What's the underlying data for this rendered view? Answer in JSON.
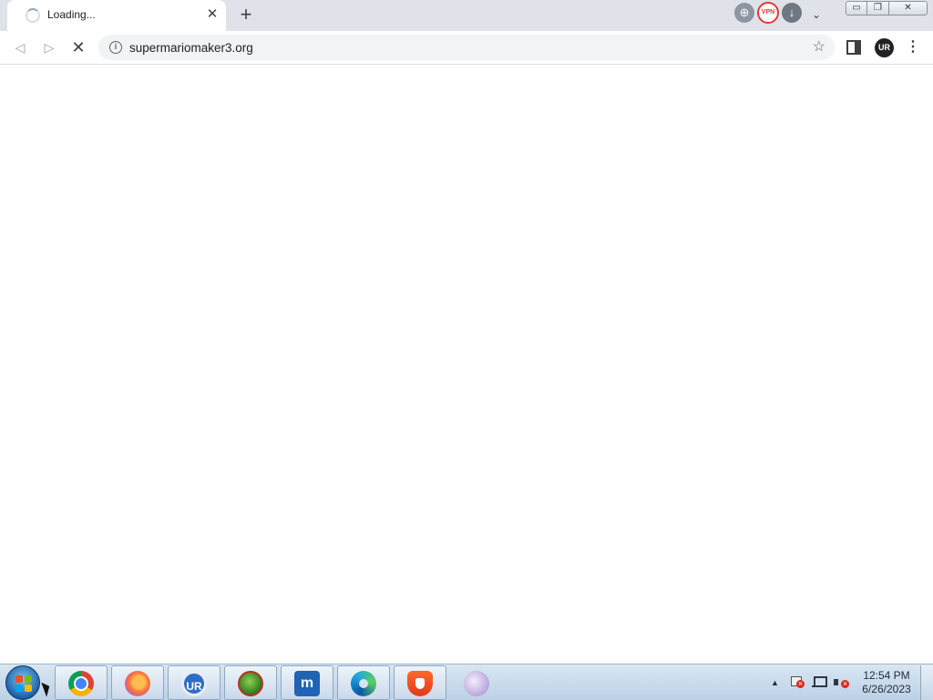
{
  "browser": {
    "tab": {
      "title": "Loading...",
      "close_symbol": "✕"
    },
    "new_tab_symbol": "+",
    "extensions": [
      {
        "name": "globe-extension-icon"
      },
      {
        "name": "vpn-extension-icon",
        "label": "VPN"
      },
      {
        "name": "download-extension-icon"
      }
    ],
    "tab_search_symbol": "⌄",
    "window_controls": {
      "minimize": "▭",
      "maximize": "❐",
      "close": "✕"
    },
    "toolbar": {
      "back_symbol": "◁",
      "forward_symbol": "▷",
      "stop_symbol": "✕",
      "url": "supermariomaker3.org",
      "info_symbol": "i",
      "bookmark_symbol": "☆",
      "profile_initials": "UR",
      "menu_symbol": "⋮"
    },
    "page_state": "loading"
  },
  "taskbar": {
    "pinned": [
      {
        "name": "chrome",
        "icon": "chrome-icon"
      },
      {
        "name": "firefox",
        "icon": "firefox-icon"
      },
      {
        "name": "ur-browser",
        "icon": "ur-browser-icon",
        "label": "UR"
      },
      {
        "name": "green-app",
        "icon": "green-app-icon"
      },
      {
        "name": "maxthon",
        "icon": "maxthon-icon",
        "label": "m"
      },
      {
        "name": "edge",
        "icon": "edge-icon"
      },
      {
        "name": "brave",
        "icon": "brave-icon"
      },
      {
        "name": "eagle",
        "icon": "eagle-icon"
      }
    ],
    "tray": {
      "overflow_symbol": "▲",
      "time": "12:54 PM",
      "date": "6/26/2023"
    }
  },
  "colors": {
    "tabstrip": "#dfe3e9",
    "omnibox": "#f1f3f4",
    "vpn_red": "#e53935",
    "taskbar_top": "#d9e6f3",
    "taskbar_bottom": "#bcd1e6"
  }
}
